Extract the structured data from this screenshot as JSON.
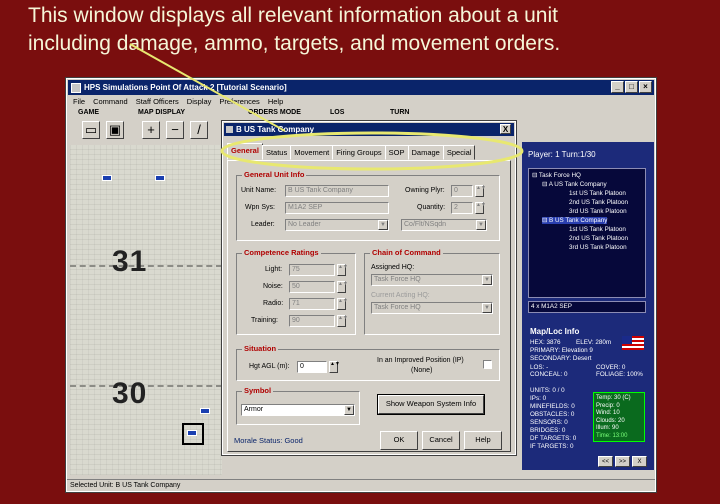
{
  "caption": {
    "line1": "This window displays all relevant information about a unit",
    "line2": "including damage, ammo, targets, and movement orders."
  },
  "app": {
    "title": "HPS Simulations Point Of Attack 2 [Tutorial Scenario]",
    "menu": [
      "File",
      "Command",
      "Staff Officers",
      "Display",
      "Preferences",
      "Help"
    ],
    "toolbar_groups": [
      "GAME",
      "MAP DISPLAY",
      "ORDERS MODE",
      "LOS",
      "TURN"
    ],
    "status_bar": "Selected Unit: B  US Tank Company"
  },
  "map": {
    "grid_numbers": [
      "31",
      "30"
    ]
  },
  "side_panel": {
    "player_turn": "Player: 1  Turn:1/30",
    "tree": [
      {
        "label": "Task Force HQ",
        "indent": 0,
        "marker": "⊟"
      },
      {
        "label": "A  US Tank Company",
        "indent": 1,
        "marker": "⊟"
      },
      {
        "label": "1st US Tank Platoon",
        "indent": 2,
        "marker": ""
      },
      {
        "label": "2nd US Tank Platoon",
        "indent": 2,
        "marker": ""
      },
      {
        "label": "3rd US Tank Platoon",
        "indent": 2,
        "marker": ""
      },
      {
        "label": "B  US Tank Company",
        "indent": 1,
        "marker": "⊟",
        "selected": true
      },
      {
        "label": "1st US Tank Platoon",
        "indent": 2,
        "marker": ""
      },
      {
        "label": "2nd US Tank Platoon",
        "indent": 2,
        "marker": ""
      },
      {
        "label": "3rd US Tank Platoon",
        "indent": 2,
        "marker": ""
      }
    ],
    "equipment": "4 x M1A2 SEP",
    "map_loc_title": "Map/Loc Info",
    "hex": "HEX: 3876",
    "elev": "ELEV: 280m",
    "primary": "PRIMARY: Elevation 9",
    "secondary": "SECONDARY: Desert",
    "los": "LOS: -",
    "conceal": "CONCEAL: 0",
    "cover": "COVER: 0",
    "foliage": "FOLIAGE: 100%",
    "units": "UNITS: 0 / 0",
    "ips": "IPs: 0",
    "minefields": "MINEFIELDS: 0",
    "obstacles": "OBSTACLES: 0",
    "sensors": "SENSORS: 0",
    "bridges": "BRIDGES: 0",
    "df_targets": "DF TARGETS: 0",
    "if_targets": "IF TARGETS: 0",
    "weather": {
      "temp": "Temp: 30 (C)",
      "precip": "Precip: 0",
      "wind": "Wind: 10",
      "clouds": "Clouds: 20",
      "illum": "Illum: 90",
      "time": "Time: 13:00"
    },
    "nav_buttons": [
      "<<",
      ">>",
      "X"
    ]
  },
  "dialog": {
    "title": "B  US Tank Company",
    "close": "X",
    "tabs": [
      "General",
      "Status",
      "Movement",
      "Firing Groups",
      "SOP",
      "Damage",
      "Special"
    ],
    "active_tab": "General",
    "general_info": {
      "heading": "General Unit Info",
      "unit_name_label": "Unit Name:",
      "unit_name": "B  US Tank Company",
      "owning_plyr_label": "Owning Plyr:",
      "owning_plyr": "0",
      "wpn_sys_label": "Wpn Sys:",
      "wpn_sys": "M1A2 SEP",
      "quantity_label": "Quantity:",
      "quantity": "2",
      "leader_label": "Leader:",
      "leader": "No Leader",
      "echelon": "Co/Flt/NSqdn"
    },
    "competence": {
      "heading": "Competence Ratings",
      "light_label": "Light:",
      "light": "75",
      "noise_label": "Noise:",
      "noise": "50",
      "radio_label": "Radio:",
      "radio": "71",
      "training_label": "Training:",
      "training": "90"
    },
    "chain": {
      "heading": "Chain of Command",
      "assigned_label": "Assigned HQ:",
      "assigned": "Task Force HQ",
      "current_label": "Current Acting HQ:",
      "current": "Task Force HQ"
    },
    "situation": {
      "heading": "Situation",
      "hgt_label": "Hgt AGL (m):",
      "hgt": "0",
      "ip_label": "In an Improved Position (IP)",
      "ip_value": "(None)"
    },
    "symbol": {
      "heading": "Symbol",
      "value": "Armor"
    },
    "show_weapon_button": "Show Weapon System Info",
    "morale": "Morale Status: Good",
    "ok": "OK",
    "cancel": "Cancel",
    "help": "Help"
  },
  "colors": {
    "background": "#7a0e0e",
    "caption_text": "#f6f6d8",
    "highlight_ellipse": "#e8e870",
    "title_bar": "#0a246a",
    "active_tab": "#b00000",
    "side_panel": "#1c2a7a"
  }
}
